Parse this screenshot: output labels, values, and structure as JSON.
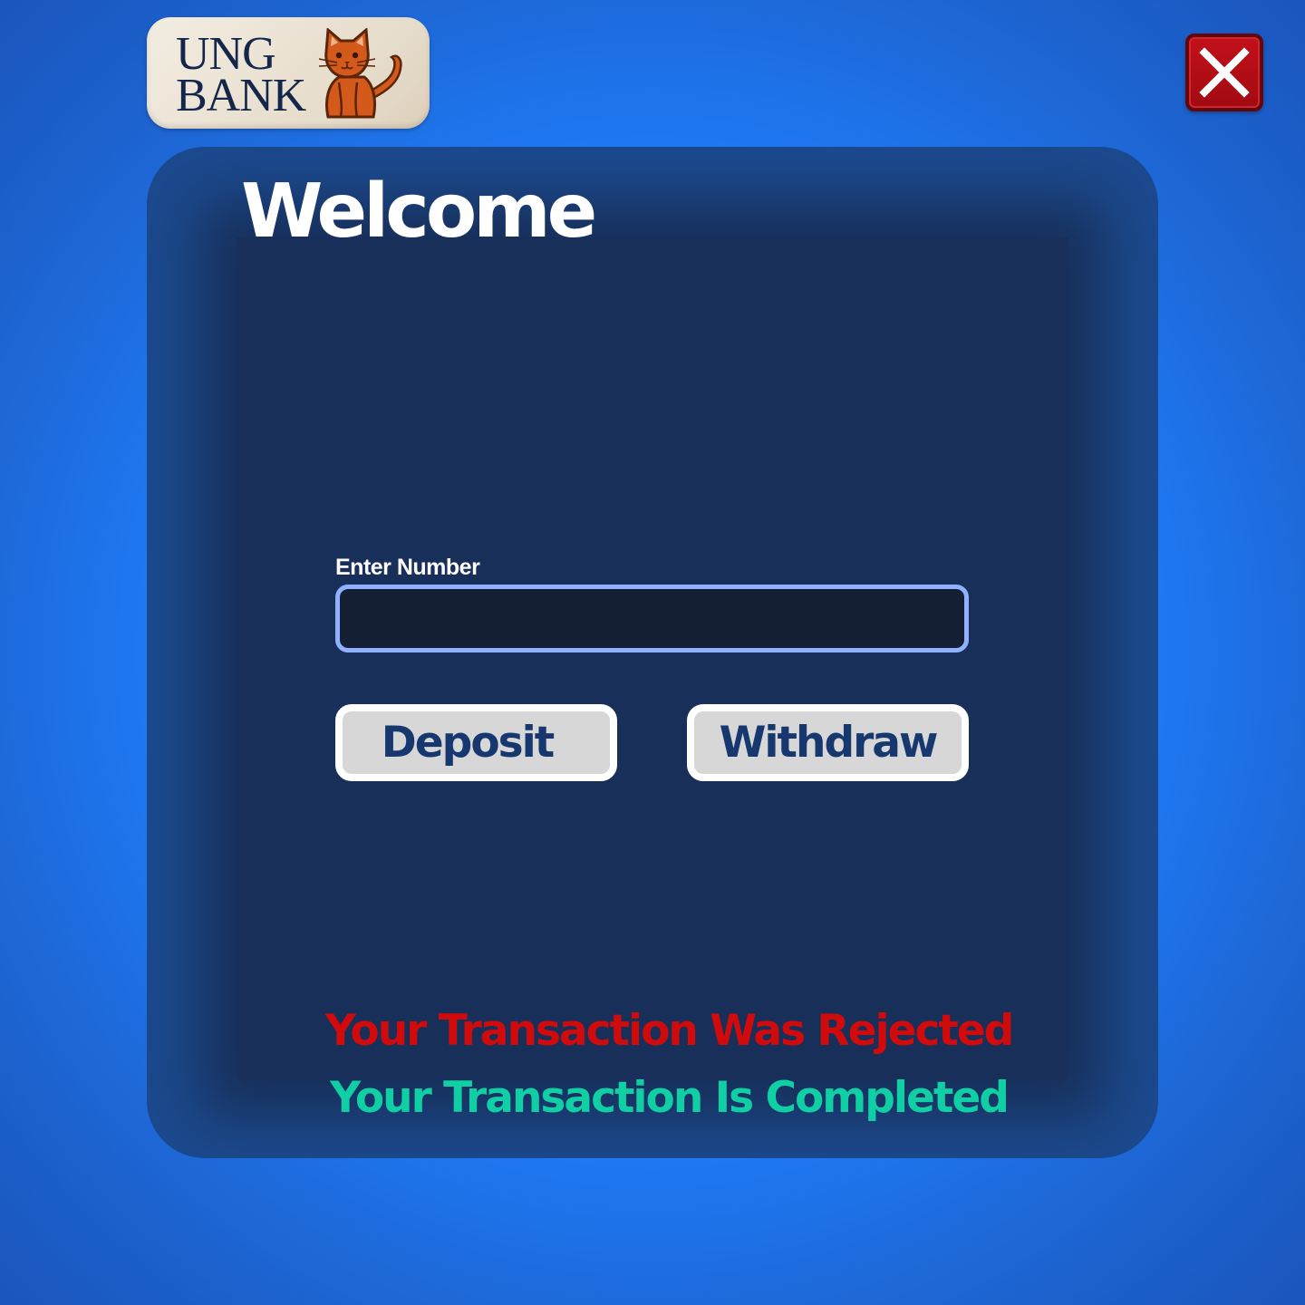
{
  "logo": {
    "line1": "UNG",
    "line2": "BANK",
    "icon": "cat-icon"
  },
  "close_button": {
    "icon": "close-icon"
  },
  "panel": {
    "title": "Welcome",
    "input": {
      "label": "Enter Number",
      "value": "",
      "placeholder": ""
    },
    "buttons": {
      "deposit": "Deposit",
      "withdraw": "Withdraw"
    },
    "messages": {
      "rejected": "Your Transaction Was Rejected",
      "completed": "Your Transaction Is Completed"
    }
  },
  "colors": {
    "background": "#1f7bf5",
    "panel": "#1c4a8e",
    "panel_inner": "#172f59",
    "input_border": "#8fb1ff",
    "button_face": "#d7d7d7",
    "button_text": "#17386f",
    "rejected": "#d10b0b",
    "completed": "#10cfa4",
    "close": "#b30d15"
  }
}
